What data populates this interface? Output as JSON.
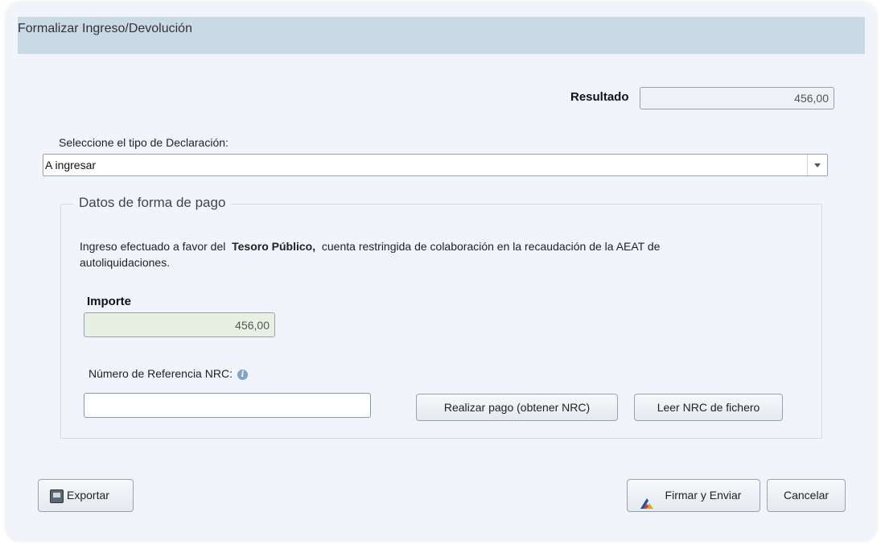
{
  "dialog": {
    "title": "Formalizar Ingreso/Devolución"
  },
  "resultado": {
    "label": "Resultado",
    "value": "456,00"
  },
  "declaration_type": {
    "label": "Seleccione el tipo de Declaración:",
    "selected": "A ingresar"
  },
  "payment": {
    "legend": "Datos de forma de pago",
    "description_prefix": "Ingreso efectuado a favor del",
    "description_bold": "Tesoro Público,",
    "description_line1_suffix": "cuenta restringida de colaboración en la recaudación de la AEAT de",
    "description_line2": "autoliquidaciones.",
    "importe_label": "Importe",
    "importe_value": "456,00",
    "nrc_label": "Número de Referencia NRC:",
    "nrc_value": "",
    "realizar_pago_label": "Realizar pago (obtener NRC)",
    "leer_nrc_label": "Leer NRC de fichero"
  },
  "footer": {
    "exportar_label": "Exportar",
    "firmar_label": "Firmar y Enviar",
    "cancelar_label": "Cancelar"
  },
  "colors": {
    "title_bar": "#cad9e6",
    "dialog_bg": "#f1f5fb",
    "importe_bg": "#e7f1e3"
  }
}
